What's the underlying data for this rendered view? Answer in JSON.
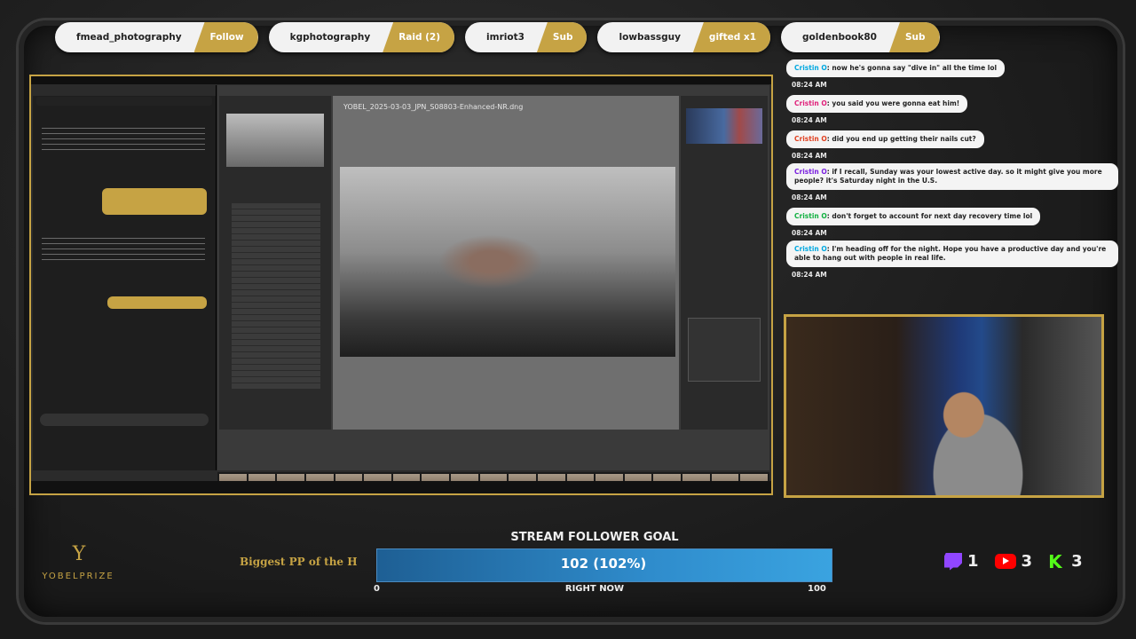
{
  "alerts": [
    {
      "name": "fmead_photography",
      "type": "Follow"
    },
    {
      "name": "kgphotography",
      "type": "Raid (2)"
    },
    {
      "name": "imriot3",
      "type": "Sub"
    },
    {
      "name": "lowbassguy",
      "type": "gifted x1"
    },
    {
      "name": "goldenbook80",
      "type": "Sub"
    }
  ],
  "lightroom": {
    "file_title": "YOBEL_2025-03-03_JPN_S08803-Enhanced-NR.dng"
  },
  "chat": [
    {
      "user": "Cristin O",
      "text": ": now he's gonna say \"dive in\" all the time lol",
      "time": "08:24 AM"
    },
    {
      "user": "Cristin O",
      "text": ": you said you were gonna eat him!",
      "time": "08:24 AM"
    },
    {
      "user": "Cristin O",
      "text": ": did you end up getting their nails cut?",
      "time": "08:24 AM"
    },
    {
      "user": "Cristin O",
      "text": ": if I recall, Sunday was your lowest active day. so it might give you more people? it's Saturday night in the U.S.",
      "time": "08:24 AM"
    },
    {
      "user": "Cristin O",
      "text": ": don't forget to account for next day recovery time lol",
      "time": "08:24 AM"
    },
    {
      "user": "Cristin O",
      "text": ": I'm heading off for the night. Hope you have a productive day and you're able to hang out with people in real life.",
      "time": "08:24 AM"
    }
  ],
  "branding": {
    "logo_text": "YOBELPRIZE",
    "ticker": "Biggest PP of the H"
  },
  "goal": {
    "title": "STREAM FOLLOWER GOAL",
    "value_label": "102 (102%)",
    "progress": 1.0,
    "min": "0",
    "mid": "RIGHT NOW",
    "max": "100"
  },
  "counts": {
    "twitch": "1",
    "youtube": "3",
    "kick": "3"
  },
  "colors": {
    "gold": "#c6a344",
    "twitch": "#9146ff",
    "youtube": "#ff0000",
    "kick": "#53fc18"
  }
}
